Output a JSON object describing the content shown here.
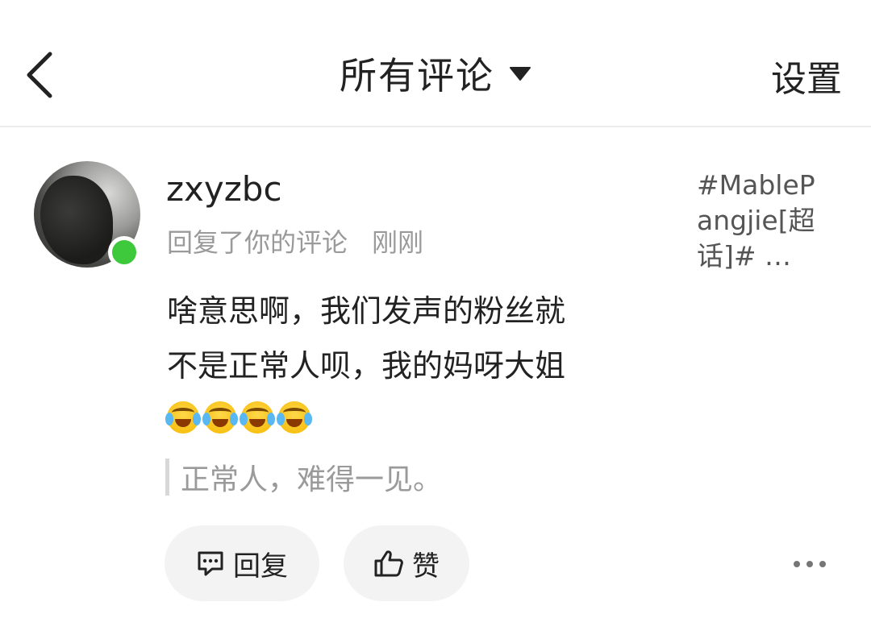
{
  "header": {
    "title": "所有评论",
    "settings_label": "设置"
  },
  "comment": {
    "username": "zxyzbc",
    "action_text": "回复了你的评论",
    "timestamp": "刚刚",
    "topic": "#MablePangjie[超话]#  …",
    "body_line1": "啥意思啊，我们发声的粉丝就",
    "body_line2": "不是正常人呗，我的妈呀大姐",
    "emoji_count_label": "crying-laughing-emoji x4",
    "quoted_text": "正常人，难得一见。",
    "online_status_color": "#3ec83c"
  },
  "actions": {
    "reply_label": "回复",
    "like_label": "赞"
  },
  "icons": {
    "back": "chevron-left-icon",
    "dropdown": "caret-down-icon",
    "reply": "comment-bubble-icon",
    "like": "thumbs-up-icon",
    "more": "more-horizontal-icon"
  }
}
